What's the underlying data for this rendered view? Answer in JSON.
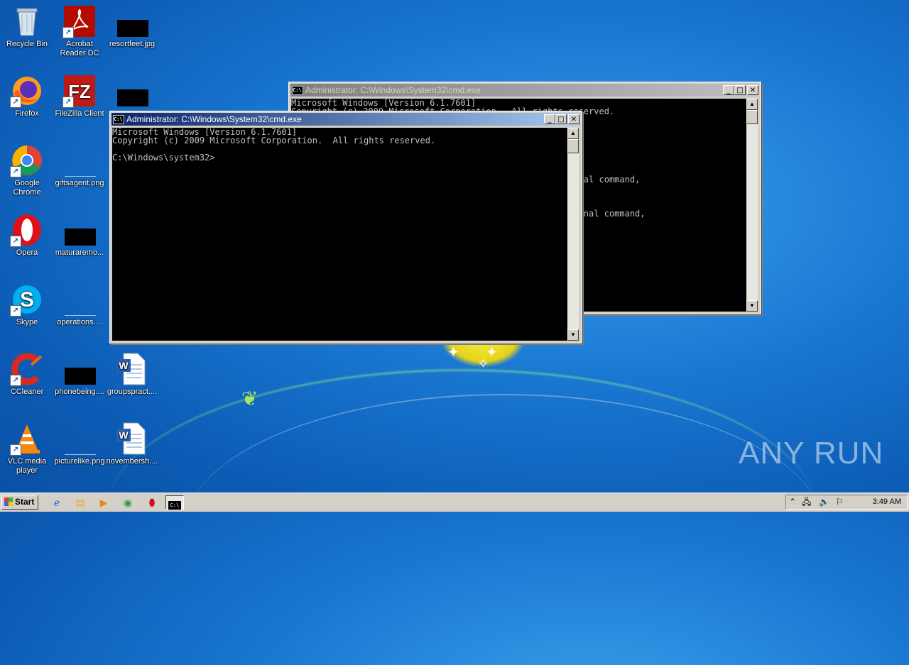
{
  "desktop": {
    "icons": [
      {
        "label": "Recycle Bin",
        "icon": "recycle-bin-icon"
      },
      {
        "label": "Acrobat Reader DC",
        "icon": "acrobat-icon"
      },
      {
        "label": "resortfeet.jpg",
        "icon": "image-file-icon"
      },
      {
        "label": "Firefox",
        "icon": "firefox-icon"
      },
      {
        "label": "FileZilla Client",
        "icon": "filezilla-icon"
      },
      {
        "label": "Google Chrome",
        "icon": "chrome-icon"
      },
      {
        "label": "giftsagent.png",
        "icon": "image-file-icon"
      },
      {
        "label": "Opera",
        "icon": "opera-icon"
      },
      {
        "label": "maturaremo...",
        "icon": "image-file-icon"
      },
      {
        "label": "Skype",
        "icon": "skype-icon"
      },
      {
        "label": "operations....",
        "icon": "image-file-icon"
      },
      {
        "label": "CCleaner",
        "icon": "ccleaner-icon"
      },
      {
        "label": "phonebeing....",
        "icon": "image-file-icon"
      },
      {
        "label": "groupspract....",
        "icon": "word-doc-icon"
      },
      {
        "label": "VLC media player",
        "icon": "vlc-icon"
      },
      {
        "label": "picturelike.png",
        "icon": "image-file-icon"
      },
      {
        "label": "novembersh....",
        "icon": "word-doc-icon"
      }
    ]
  },
  "back_window": {
    "title": "Administrator: C:\\Windows\\System32\\cmd.exe",
    "lines": [
      "Microsoft Windows [Version 6.1.7601]",
      "Copyright (c) 2009 Microsoft Corporation.  All rights reserved.",
      "",
      "",
      "",
      "",
      "",
      "",
      "",
      "                                                       rnal command,",
      "",
      "",
      "",
      "                                                       ernal command,"
    ]
  },
  "front_window": {
    "title": "Administrator: C:\\Windows\\System32\\cmd.exe",
    "lines": [
      "Microsoft Windows [Version 6.1.7601]",
      "Copyright (c) 2009 Microsoft Corporation.  All rights reserved.",
      "",
      "C:\\Windows\\system32>"
    ]
  },
  "taskbar": {
    "start_label": "Start",
    "clock": "3:49 AM"
  },
  "watermark": "ANY RUN"
}
